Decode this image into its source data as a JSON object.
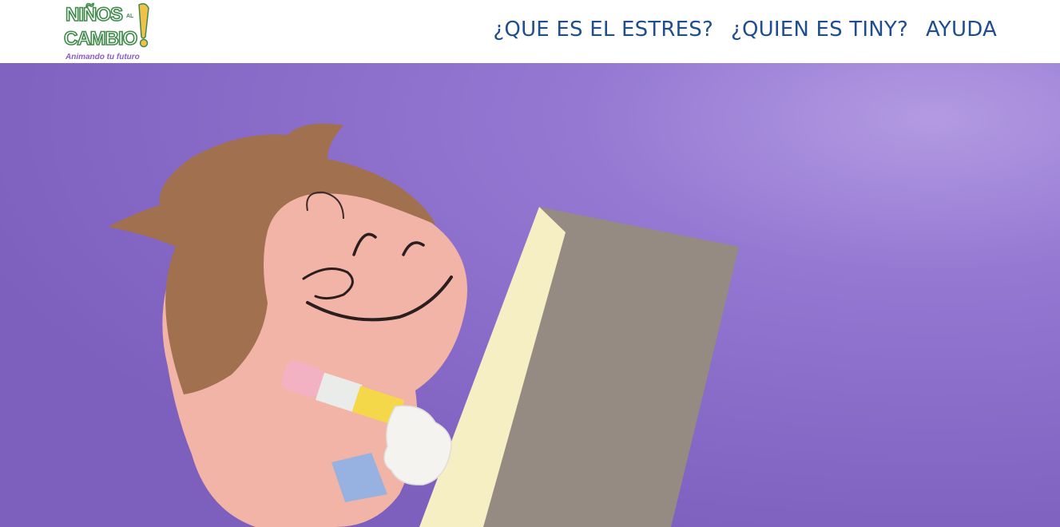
{
  "header": {
    "logo": {
      "line1": "NIÑOS",
      "small": "AL",
      "line2": "CAMBIO",
      "tagline": "Animando tu futuro"
    },
    "nav": [
      {
        "label": "¿QUE ES EL ESTRES?"
      },
      {
        "label": "¿QUIEN ES TINY?"
      },
      {
        "label": "AYUDA"
      }
    ]
  },
  "colors": {
    "nav_text": "#1f4e8f",
    "hero_background": "#8a6cc4",
    "logo_green": "#3f8a4a",
    "logo_yellow": "#f1c14a",
    "tagline_purple": "#8a5cc4"
  },
  "hero": {
    "illustration": "animated-boy-with-paintbrush-and-canvas"
  }
}
